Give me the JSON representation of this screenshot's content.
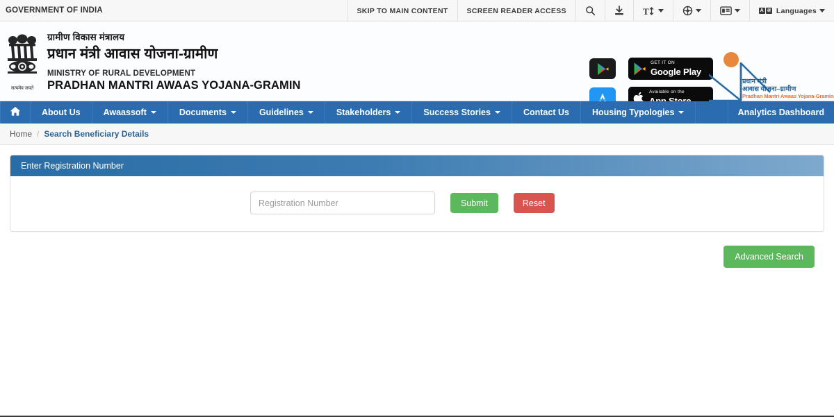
{
  "topbar": {
    "gov_label": "GOVERNMENT OF INDIA",
    "skip_link": "SKIP TO MAIN CONTENT",
    "screen_reader": "SCREEN READER ACCESS",
    "search_icon": "search-icon",
    "download_icon": "download-icon",
    "text_size_icon": "text-size-icon",
    "accessibility_icon": "accessibility-contrast-icon",
    "sitemap_icon": "sitemap-icon",
    "languages_label": "Languages",
    "lang_glyph_a": "A",
    "lang_glyph_b": "अ"
  },
  "masthead": {
    "emblem_name": "ashoka-emblem",
    "emblem_caption": "सत्यमेव जयते",
    "ministry_hi": "ग्रामीण विकास मंत्रालय",
    "scheme_hi": "प्रधान मंत्री आवास योजना-ग्रामीण",
    "ministry_en": "MINISTRY OF RURAL DEVELOPMENT",
    "scheme_en": "PRADHAN MANTRI AWAAS YOJANA-GRAMIN",
    "google_play": {
      "small": "GET IT ON",
      "big": "Google Play"
    },
    "app_store": {
      "small": "Available on the",
      "big": "App Store"
    },
    "logo": {
      "line1": "प्रधान मंत्री",
      "line2": "आवास योजना–ग्रामीण",
      "line3": "Pradhan Mantri Awaas Yojana-Gramin",
      "sun_color": "#e8883c",
      "house_color": "#2a6ca5"
    }
  },
  "nav": {
    "home_icon": "home-icon",
    "items": [
      {
        "label": "About Us",
        "has_caret": false
      },
      {
        "label": "Awaassoft",
        "has_caret": true
      },
      {
        "label": "Documents",
        "has_caret": true
      },
      {
        "label": "Guidelines",
        "has_caret": true
      },
      {
        "label": "Stakeholders",
        "has_caret": true
      },
      {
        "label": "Success Stories",
        "has_caret": true
      },
      {
        "label": "Contact Us",
        "has_caret": false
      },
      {
        "label": "Housing Typologies",
        "has_caret": true
      }
    ],
    "right_item": "Analytics Dashboard",
    "bar_color": "#2b6cb0"
  },
  "breadcrumb": {
    "home": "Home",
    "separator": "/",
    "current": "Search Beneficiary Details"
  },
  "panel": {
    "title": "Enter Registration Number",
    "input_placeholder": "Registration Number",
    "input_value": "",
    "submit_label": "Submit",
    "reset_label": "Reset",
    "submit_color": "#5cb85c",
    "reset_color": "#d9534f"
  },
  "actions": {
    "advanced_search_label": "Advanced Search"
  }
}
